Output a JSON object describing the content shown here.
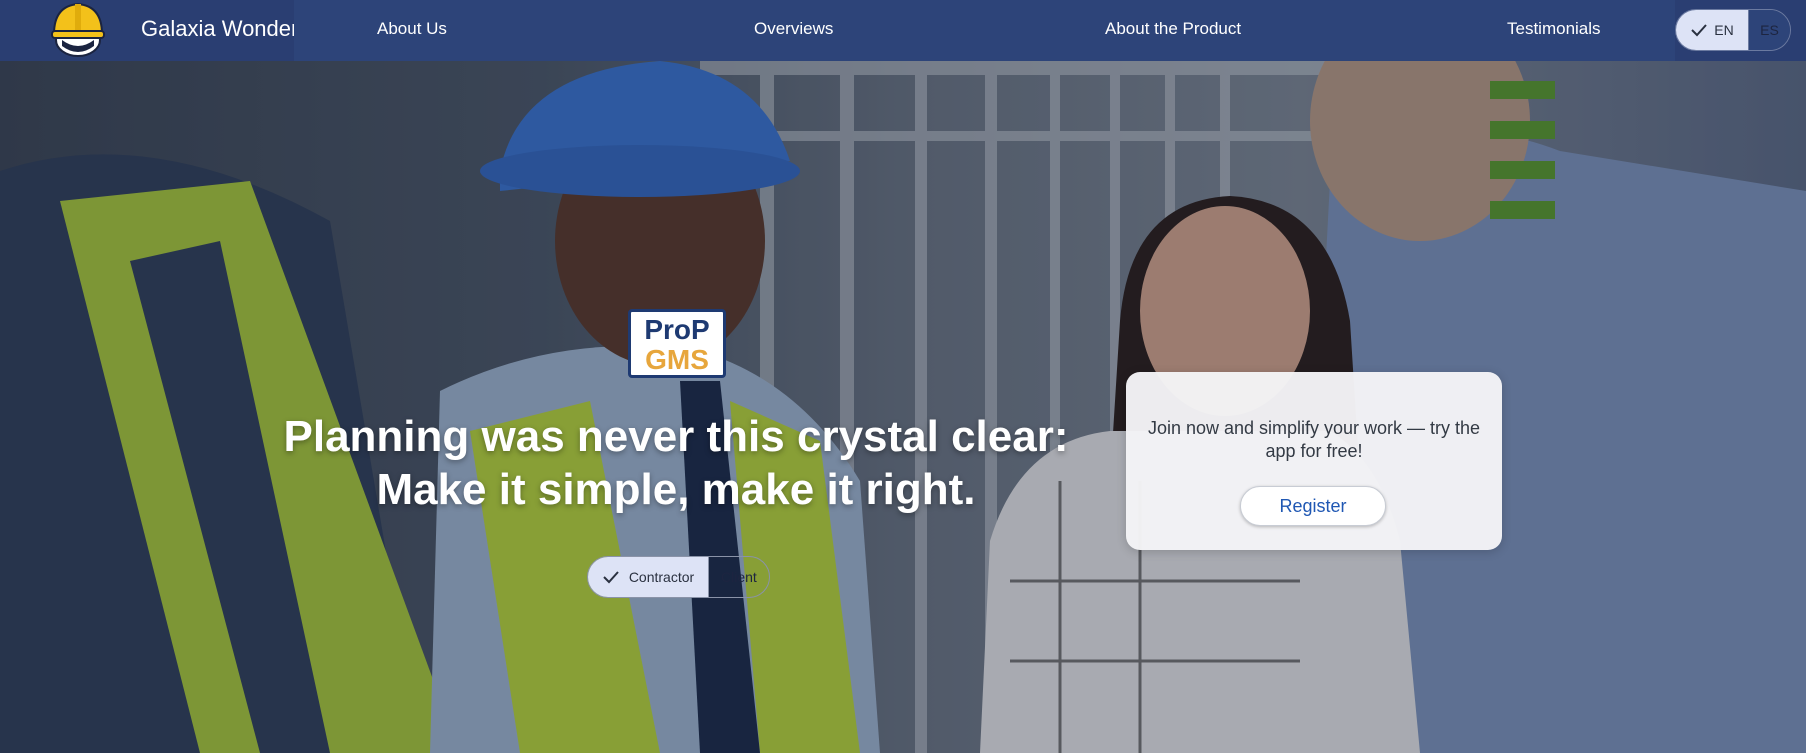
{
  "brand": {
    "name": "Galaxia Wonder",
    "logo_icon": "hard-hat-icon"
  },
  "nav": {
    "items": [
      {
        "label": "About Us"
      },
      {
        "label": "Overviews"
      },
      {
        "label": "About the Product"
      },
      {
        "label": "Testimonials"
      }
    ]
  },
  "language": {
    "options": [
      "EN",
      "ES"
    ],
    "selected": "EN",
    "check_icon": "check-icon"
  },
  "hero": {
    "product_logo": {
      "line1": "ProP",
      "line2": "GMS"
    },
    "headline_line1": "Planning was never this crystal clear:",
    "headline_line2": "Make it simple, make it right.",
    "role_toggle": {
      "options": [
        "Contractor",
        "Client"
      ],
      "selected": "Contractor"
    }
  },
  "signup_card": {
    "text": "Join now and simplify your work — try the app for free!",
    "button_label": "Register"
  },
  "colors": {
    "topbar": "#2a3e72",
    "nav": "#2d4479",
    "accent_blue": "#1f57b3",
    "logo_gold": "#e7a63c",
    "toggle_selected": "#dde3f6"
  }
}
